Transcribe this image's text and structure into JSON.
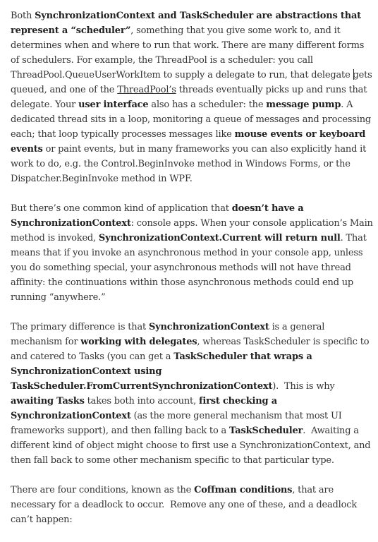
{
  "paragraphs": [
    [
      {
        "t": "Both "
      },
      {
        "t": "SynchronizationContext and TaskScheduler are abstractions that represent a “scheduler”",
        "b": true
      },
      {
        "t": ", something that you give some work to, and it determines when and where to run that work. There are many different forms of schedulers. For example, the ThreadPool is a scheduler: you call ThreadPool.QueueUserWorkItem to supply a delegate to run, that delegate "
      },
      {
        "caret": true
      },
      {
        "t": "gets queued, and one of the "
      },
      {
        "t": "ThreadPool’s",
        "link": true
      },
      {
        "t": " threads eventually picks up and runs that delegate. Your "
      },
      {
        "t": "user interface",
        "b": true
      },
      {
        "t": " also has a scheduler: the "
      },
      {
        "t": "message pump",
        "b": true
      },
      {
        "t": ". A dedicated thread sits in a loop, monitoring a queue of messages and processing each; that loop typically processes messages like "
      },
      {
        "t": "mouse events or keyboard events",
        "b": true
      },
      {
        "t": " or paint events, but in many frameworks you can also explicitly hand it work to do, e.g. the Control.BeginInvoke method in Windows Forms, or the Dispatcher.BeginInvoke method in WPF."
      }
    ],
    [
      {
        "t": "But there’s one common kind of application that "
      },
      {
        "t": "doesn’t have a SynchronizationContext",
        "b": true
      },
      {
        "t": ": console apps. When your console application’s Main method is invoked, "
      },
      {
        "t": "SynchronizationContext.Current will return null",
        "b": true
      },
      {
        "t": ". That means that if you invoke an asynchronous method in your console app, unless you do something special, your asynchronous methods will not have thread affinity: the continuations within those asynchronous methods could end up running “anywhere.”"
      }
    ],
    [
      {
        "t": "The primary difference is that "
      },
      {
        "t": "SynchronizationContext",
        "b": true
      },
      {
        "t": " is a general mechanism for "
      },
      {
        "t": "working with delegates",
        "b": true
      },
      {
        "t": ", whereas TaskScheduler is specific to and catered to Tasks (you can get a "
      },
      {
        "t": "TaskScheduler that wraps a SynchronizationContext using TaskScheduler.FromCurrentSynchronizationContext",
        "b": true
      },
      {
        "t": ").  This is why "
      },
      {
        "t": "awaiting Tasks",
        "b": true
      },
      {
        "t": " takes both into account, "
      },
      {
        "t": "first checking a SynchronizationContext",
        "b": true
      },
      {
        "t": " (as the more general mechanism that most UI frameworks support), and then falling back to a "
      },
      {
        "t": "TaskScheduler",
        "b": true
      },
      {
        "t": ".  Awaiting a different kind of object might choose to first use a SynchronizationContext, and then fall back to some other mechanism specific to that particular type."
      }
    ],
    [
      {
        "t": "There are four conditions, known as the "
      },
      {
        "t": "Coffman conditions",
        "b": true
      },
      {
        "t": ", that are necessary for a deadlock to occur.  Remove any one of these, and a deadlock can’t happen:"
      }
    ]
  ]
}
